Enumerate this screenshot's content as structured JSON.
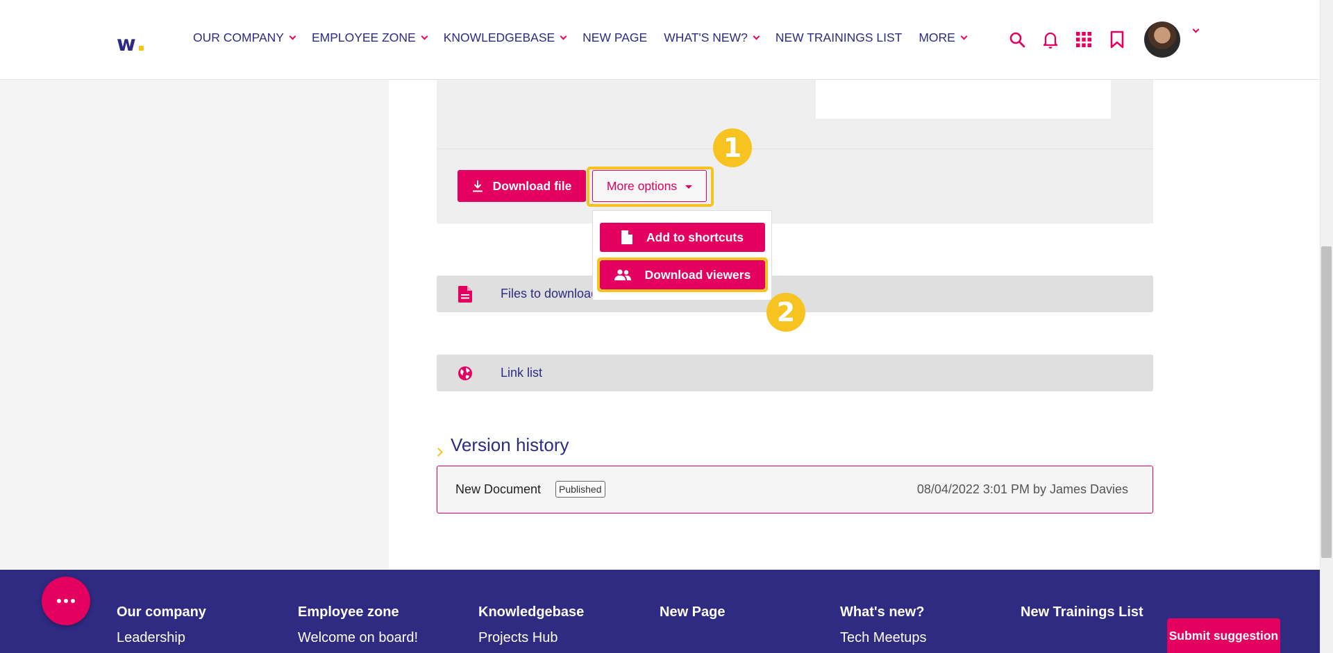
{
  "header": {
    "logo_text": "w",
    "nav": [
      {
        "label": "OUR COMPANY",
        "has_dropdown": true
      },
      {
        "label": "EMPLOYEE ZONE",
        "has_dropdown": true
      },
      {
        "label": "KNOWLEDGEBASE",
        "has_dropdown": true
      },
      {
        "label": "NEW PAGE",
        "has_dropdown": false
      },
      {
        "label": "WHAT'S NEW?",
        "has_dropdown": true
      },
      {
        "label": "NEW TRAININGS LIST",
        "has_dropdown": false
      },
      {
        "label": "MORE",
        "has_dropdown": true
      }
    ],
    "icons": [
      "search-icon",
      "bell-icon",
      "apps-grid-icon",
      "bookmark-icon"
    ]
  },
  "document": {
    "download_label": "Download file",
    "more_options_label": "More options",
    "menu": {
      "add_shortcuts": "Add to shortcuts",
      "download_viewers": "Download viewers"
    },
    "steps": [
      "1",
      "2"
    ]
  },
  "sections": {
    "files_label": "Files to download",
    "links_label": "Link list"
  },
  "version_history": {
    "title": "Version history",
    "rows": [
      {
        "name": "New Document",
        "status": "Published",
        "meta": "08/04/2022 3:01 PM by James Davies"
      }
    ]
  },
  "footer": {
    "columns": [
      {
        "heading": "Our company",
        "link": "Leadership"
      },
      {
        "heading": "Employee zone",
        "link": "Welcome on board!"
      },
      {
        "heading": "Knowledgebase",
        "link": "Projects Hub"
      },
      {
        "heading": "New Page",
        "link": ""
      },
      {
        "heading": "What's new?",
        "link": "Tech Meetups"
      },
      {
        "heading": "New Trainings List",
        "link": ""
      }
    ],
    "suggest_label": "Submit suggestion"
  },
  "colors": {
    "primary": "#e3005e",
    "navy": "#2f2a82",
    "highlight": "#f7c321"
  }
}
